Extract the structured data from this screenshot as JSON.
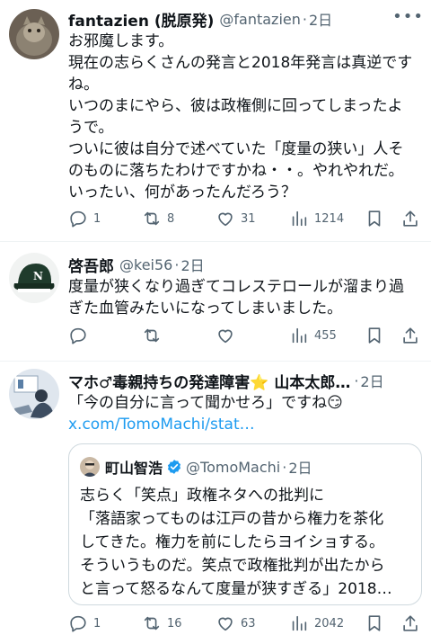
{
  "tweets": [
    {
      "name": "fantazien (脱原発)",
      "handle": "@fantazien",
      "time": "2日",
      "lines": [
        "お邪魔します。",
        "現在の志らくさんの発言と2018年発言は真逆です",
        "ね。",
        "いつのまにやら、彼は政権側に回ってしまったよ",
        "うで。",
        "ついに彼は自分で述べていた「度量の狭い」人そ",
        "のものに落ちたわけですかね・・。やれやれだ。",
        "いったい、何があったんだろう？"
      ],
      "replies": "1",
      "retweets": "8",
      "likes": "31",
      "views": "1214"
    },
    {
      "name": "啓吾郎",
      "handle": "@kei56",
      "time": "2日",
      "lines": [
        "度量が狭くなり過ぎてコレステロールが溜まり過",
        "ぎた血管みたいになってしまいました。"
      ],
      "replies": "",
      "retweets": "",
      "likes": "",
      "views": "455"
    },
    {
      "name": "マホ♂毒親持ちの発達障害⭐ 山本太郎…",
      "handle": "",
      "time": "2日",
      "lines": [
        "「今の自分に言って聞かせろ」ですね😏"
      ],
      "link": "x.com/TomoMachi/stat…",
      "replies": "1",
      "retweets": "16",
      "likes": "63",
      "views": "2042"
    }
  ],
  "separator": "·",
  "quote": {
    "name": "町山智浩",
    "handle": "@TomoMachi",
    "time": "2日",
    "lines": [
      "志らく「笑点」政権ネタへの批判に",
      "「落語家ってものは江戸の昔から権力を茶化",
      "してきた。権力を前にしたらヨイショする。",
      "そういうものだ。笑点で政権批判が出たから",
      "と言って怒るなんて度量が狭すぎる」2018…"
    ]
  },
  "colors": {
    "text": "#0f1419",
    "secondary": "#536471",
    "link": "#1d9bf0",
    "verified": "#1d9bf0",
    "star": "#f7c948"
  },
  "icons": [
    "reply-icon",
    "retweet-icon",
    "like-icon",
    "views-icon",
    "bookmark-icon",
    "share-icon",
    "more-icon",
    "verified-icon"
  ]
}
